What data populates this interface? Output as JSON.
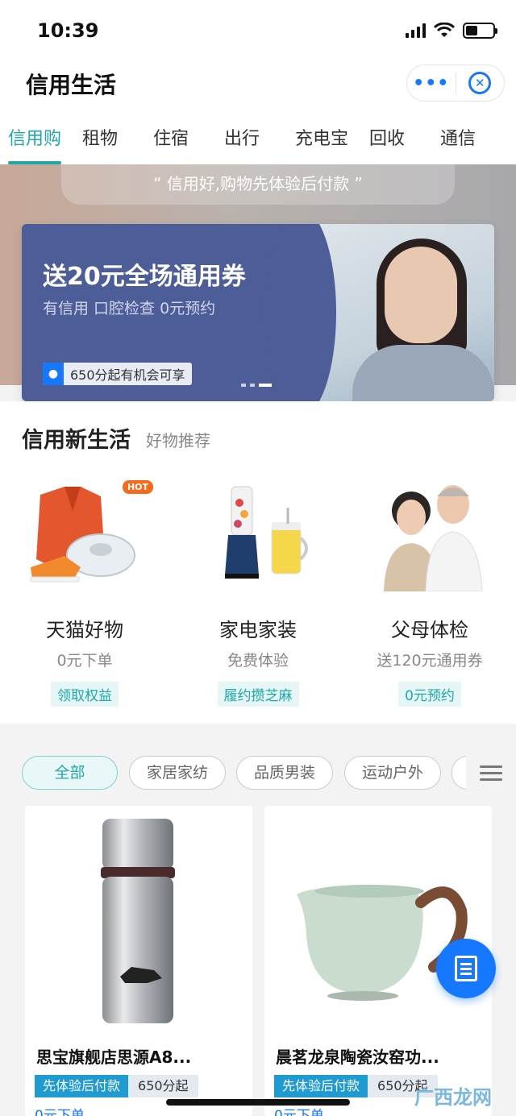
{
  "status_bar": {
    "time": "10:39"
  },
  "nav": {
    "title": "信用生活",
    "more_label": "•••"
  },
  "tabs": [
    {
      "label": "信用购",
      "active": true
    },
    {
      "label": "租物"
    },
    {
      "label": "住宿"
    },
    {
      "label": "出行"
    },
    {
      "label": "充电宝"
    },
    {
      "label": "回收"
    },
    {
      "label": "通信"
    }
  ],
  "hero": {
    "slogan": "“ 信用好,购物先体验后付款 ”",
    "banner": {
      "title": "送20元全场通用券",
      "subtitle": "有信用  口腔检查  0元预约",
      "badge": "650分起有机会可享"
    }
  },
  "section": {
    "title": "信用新生活",
    "subtitle": "好物推荐",
    "categories": [
      {
        "name": "天猫好物",
        "desc": "0元下单",
        "tag": "领取权益",
        "hot": "HOT"
      },
      {
        "name": "家电家装",
        "desc": "免费体验",
        "tag": "履约攒芝麻"
      },
      {
        "name": "父母体检",
        "desc": "送120元通用券",
        "tag": "0元预约"
      }
    ]
  },
  "filters": [
    "全部",
    "家居家纺",
    "品质男装",
    "运动户外"
  ],
  "products": [
    {
      "title": "思宝旗舰店思源A8...",
      "tag1": "先体验后付款",
      "tag2": "650分起",
      "price": "0元下单"
    },
    {
      "title": "晨茗龙泉陶瓷汝窑功...",
      "tag1": "先体验后付款",
      "tag2": "650分起",
      "price": "0元下单"
    }
  ],
  "watermark": "广西龙网",
  "colors": {
    "accent": "#20a8a8",
    "brand_blue": "#1677ff",
    "banner_bg": "#4d5d98"
  }
}
